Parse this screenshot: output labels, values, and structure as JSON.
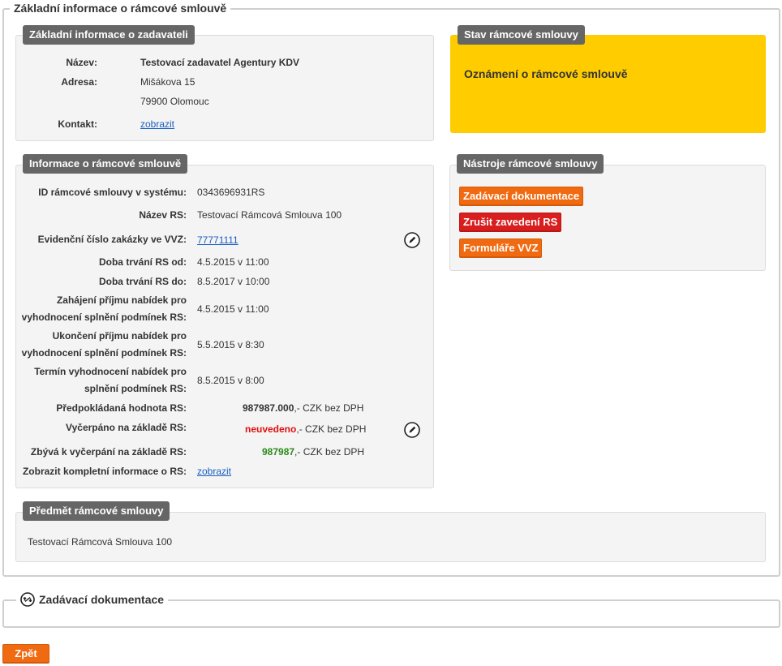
{
  "main_section": {
    "title": "Základní informace o rámcové smlouvě"
  },
  "zadavatel": {
    "header": "Základní informace o zadavateli",
    "name_label": "Název:",
    "name_value": "Testovací zadavatel Agentury KDV",
    "address_label": "Adresa:",
    "address_line1": "Mišákova 15",
    "address_line2": "79900 Olomouc",
    "contact_label": "Kontakt:",
    "contact_link": "zobrazit"
  },
  "status": {
    "header": "Stav rámcové smlouvy",
    "text": "Oznámení o rámcové smlouvě",
    "color": "#ffcc00"
  },
  "info": {
    "header": "Informace o rámcové smlouvě",
    "id_label": "ID rámcové smlouvy v systému:",
    "id_value": "0343696931RS",
    "name_label": "Název RS:",
    "name_value": "Testovací Rámcová Smlouva 100",
    "evid_label": "Evidenční číslo zakázky ve VVZ:",
    "evid_value": "77771111",
    "from_label": "Doba trvání RS od:",
    "from_value": "4.5.2015 v 11:00",
    "to_label": "Doba trvání RS do:",
    "to_value": "8.5.2017 v 10:00",
    "start_label_1": "Zahájení příjmu nabídek pro",
    "start_label_2": "vyhodnocení splnění podmínek RS:",
    "start_value": "4.5.2015 v 11:00",
    "end_label_1": "Ukončení příjmu nabídek pro",
    "end_label_2": "vyhodnocení splnění podmínek RS:",
    "end_value": "5.5.2015 v 8:30",
    "eval_label_1": "Termín vyhodnocení nabídek pro",
    "eval_label_2": "splnění podmínek RS:",
    "eval_value": "8.5.2015 v 8:00",
    "estimated_label": "Předpokládaná hodnota RS:",
    "estimated_amount": "987987.000",
    "estimated_suffix": ",- CZK bez DPH",
    "used_label": "Vyčerpáno na základě RS:",
    "used_amount": "neuvedeno",
    "used_suffix": ",- CZK bez DPH",
    "remaining_label": "Zbývá k vyčerpání na základě RS:",
    "remaining_amount": "987987",
    "remaining_suffix": ",- CZK bez DPH",
    "full_label": "Zobrazit kompletní informace o RS:",
    "full_link": "zobrazit",
    "used_color": "#e01010",
    "remaining_color": "#2a8a1a"
  },
  "tools": {
    "header": "Nástroje rámcové smlouvy",
    "btn_docs": "Zadávací dokumentace",
    "btn_cancel": "Zrušit zavedení RS",
    "btn_forms": "Formuláře VVZ"
  },
  "subject": {
    "header": "Předmět rámcové smlouvy",
    "text": "Testovací Rámcová Smlouva 100"
  },
  "docs_section": {
    "title": "Zadávací dokumentace"
  },
  "footer": {
    "back_button": "Zpět"
  },
  "icons": {
    "edit": "pencil-circle-icon",
    "toggle": "expand-toggle-icon"
  }
}
